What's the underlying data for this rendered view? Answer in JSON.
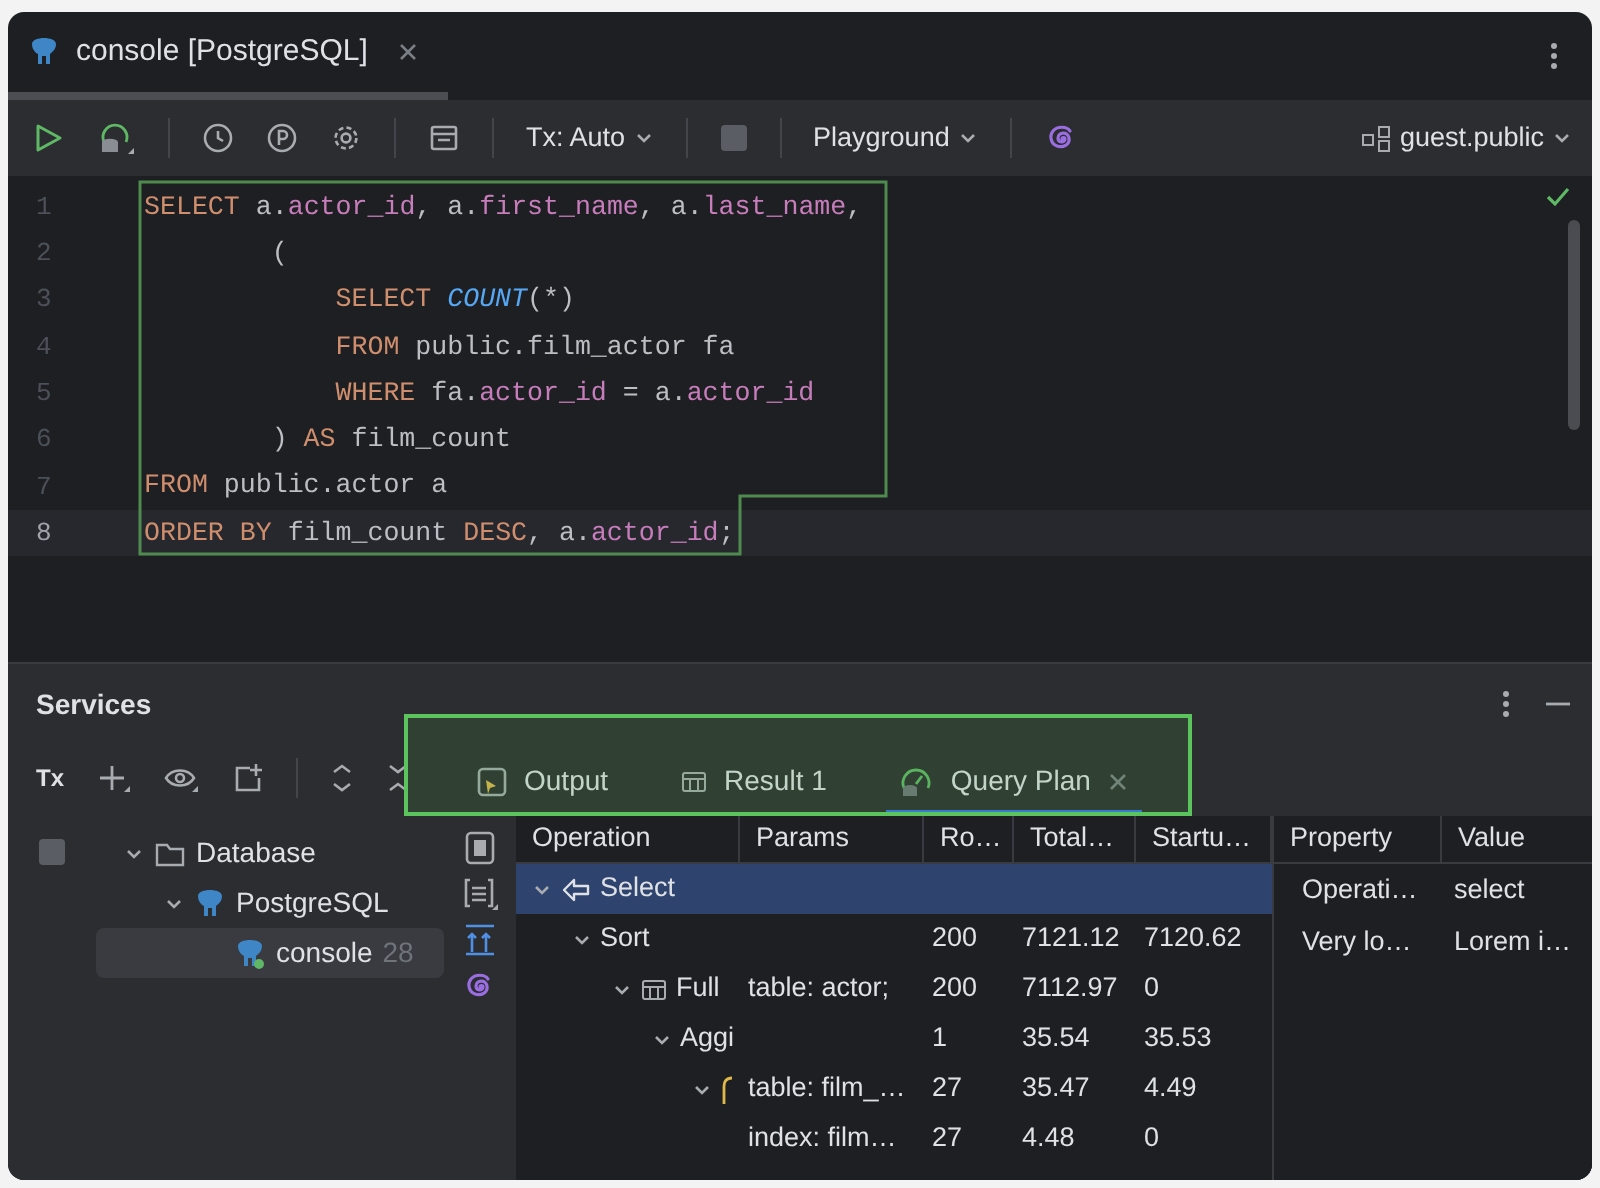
{
  "editor_tab": {
    "title": "console [PostgreSQL]",
    "selected": true
  },
  "toolbar": {
    "transaction": "Tx: Auto",
    "mode": "Playground",
    "schema": "guest.public"
  },
  "editor": {
    "lines": [
      {
        "number": "1",
        "current": false,
        "tokens": [
          {
            "kind": "keyword",
            "text": "SELECT"
          },
          {
            "kind": "plain",
            "text": " a."
          },
          {
            "kind": "field",
            "text": "actor_id"
          },
          {
            "kind": "plain",
            "text": ", a."
          },
          {
            "kind": "field",
            "text": "first_name"
          },
          {
            "kind": "plain",
            "text": ", a."
          },
          {
            "kind": "field",
            "text": "last_name"
          },
          {
            "kind": "plain",
            "text": ","
          }
        ]
      },
      {
        "number": "2",
        "current": false,
        "tokens": [
          {
            "kind": "plain",
            "text": "        ("
          }
        ]
      },
      {
        "number": "3",
        "current": false,
        "tokens": [
          {
            "kind": "keyword",
            "text": "            SELECT"
          },
          {
            "kind": "func",
            "text": " COUNT"
          },
          {
            "kind": "plain",
            "text": "(*)"
          }
        ]
      },
      {
        "number": "4",
        "current": false,
        "tokens": [
          {
            "kind": "keyword",
            "text": "            FROM"
          },
          {
            "kind": "plain",
            "text": " public.film_actor fa"
          }
        ]
      },
      {
        "number": "5",
        "current": false,
        "tokens": [
          {
            "kind": "keyword",
            "text": "            WHERE"
          },
          {
            "kind": "plain",
            "text": " fa."
          },
          {
            "kind": "field",
            "text": "actor_id"
          },
          {
            "kind": "plain",
            "text": " = a."
          },
          {
            "kind": "field",
            "text": "actor_id"
          }
        ]
      },
      {
        "number": "6",
        "current": false,
        "tokens": [
          {
            "kind": "plain",
            "text": "        ) "
          },
          {
            "kind": "keyword",
            "text": "AS"
          },
          {
            "kind": "plain",
            "text": " film_count"
          }
        ]
      },
      {
        "number": "7",
        "current": false,
        "tokens": [
          {
            "kind": "keyword",
            "text": "FROM"
          },
          {
            "kind": "plain",
            "text": " public.actor a"
          }
        ]
      },
      {
        "number": "8",
        "current": true,
        "tokens": [
          {
            "kind": "keyword",
            "text": "ORDER BY"
          },
          {
            "kind": "plain",
            "text": " film_count "
          },
          {
            "kind": "keyword",
            "text": "DESC"
          },
          {
            "kind": "plain",
            "text": ", a."
          },
          {
            "kind": "field",
            "text": "actor_id"
          },
          {
            "kind": "plain",
            "text": ";"
          }
        ]
      }
    ]
  },
  "services": {
    "title": "Services",
    "tx_label": "Tx",
    "tree": [
      {
        "label": "Database",
        "kind": "folder",
        "expanded": true,
        "selected": false,
        "children": [
          {
            "label": "PostgreSQL",
            "kind": "postgres",
            "expanded": true,
            "selected": false,
            "children": [
              {
                "label": "console",
                "kind": "console",
                "selected": true,
                "count": "28"
              }
            ]
          }
        ]
      }
    ],
    "tabs": [
      {
        "label": "Output",
        "kind": "output",
        "selected": false
      },
      {
        "label": "Result 1",
        "kind": "table",
        "selected": false
      },
      {
        "label": "Query Plan",
        "kind": "plan",
        "selected": true,
        "closable": true
      }
    ],
    "plan": {
      "columns": [
        "Operation",
        "Params",
        "Ro…",
        "Total…",
        "Startu…"
      ],
      "rows": [
        {
          "operation": "Select",
          "kind": "select",
          "expanded": true,
          "selected": true,
          "children": [
            {
              "operation": "Sort",
              "expanded": true,
              "selected": false,
              "column_3": "200",
              "column_4": "7121.12",
              "column_5": "7120.62",
              "children": [
                {
                  "operation": "Full",
                  "kind": "scan",
                  "expanded": true,
                  "selected": false,
                  "params": "table: actor;",
                  "column_3": "200",
                  "column_4": "7112.97",
                  "column_5": "0",
                  "children": [
                    {
                      "operation": "Aggi",
                      "expanded": true,
                      "selected": false,
                      "column_3": "1",
                      "column_4": "35.54",
                      "column_5": "35.53",
                      "children": [
                        {
                          "kind": "index",
                          "expanded": true,
                          "selected": false,
                          "params": "table: film_…",
                          "column_3": "27",
                          "column_4": "35.47",
                          "column_5": "4.49",
                          "children": [
                            {
                              "selected": false,
                              "params": "index: film…",
                              "column_3": "27",
                              "column_4": "4.48",
                              "column_5": "0"
                            }
                          ]
                        }
                      ]
                    }
                  ]
                }
              ]
            }
          ]
        }
      ]
    },
    "properties": {
      "columns": [
        "Property",
        "Value"
      ],
      "rows": [
        {
          "property": "Operati…",
          "value": "select"
        },
        {
          "property": "Very lo…",
          "value": "Lorem i…"
        }
      ]
    }
  }
}
